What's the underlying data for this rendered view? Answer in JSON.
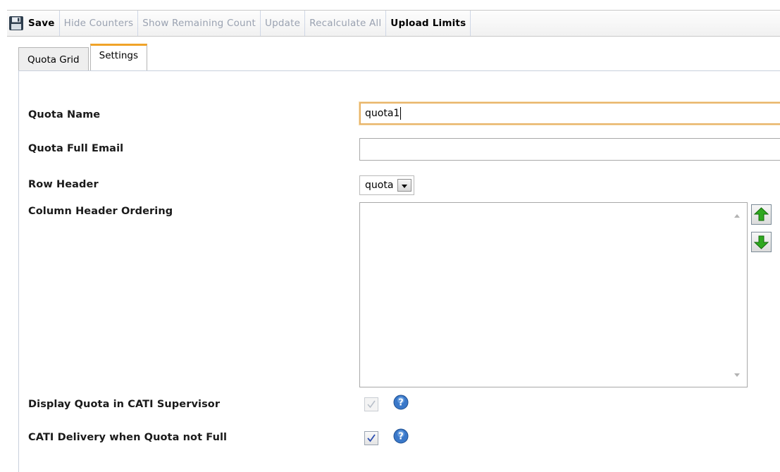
{
  "toolbar": {
    "save": "Save",
    "hide_counters": "Hide Counters",
    "show_remaining": "Show Remaining Count",
    "update": "Update",
    "recalculate_all": "Recalculate All",
    "upload_limits": "Upload Limits"
  },
  "tabs": [
    {
      "label": "Quota Grid",
      "active": false
    },
    {
      "label": "Settings",
      "active": true
    }
  ],
  "form": {
    "quota_name": {
      "label": "Quota Name",
      "value": "quota1"
    },
    "quota_full_email": {
      "label": "Quota Full Email",
      "value": ""
    },
    "row_header": {
      "label": "Row Header",
      "value": "quota"
    },
    "column_header_ordering": {
      "label": "Column Header Ordering",
      "items": []
    },
    "display_in_cati": {
      "label": "Display Quota in CATI Supervisor",
      "checked": true,
      "disabled": true
    },
    "cati_delivery": {
      "label": "CATI Delivery when Quota not Full",
      "checked": true,
      "disabled": false
    }
  },
  "icons": {
    "save": "floppy-disk-icon",
    "move_up": "arrow-up-icon",
    "move_down": "arrow-down-icon",
    "help": "question-mark-icon",
    "dropdown": "chevron-down-icon"
  },
  "colors": {
    "accent_tab": "#f0a328",
    "focus_border": "#e8b56a",
    "disabled_text": "#9aa2b1",
    "arrow_green": "#2fa81f",
    "help_blue": "#3a78c9"
  }
}
